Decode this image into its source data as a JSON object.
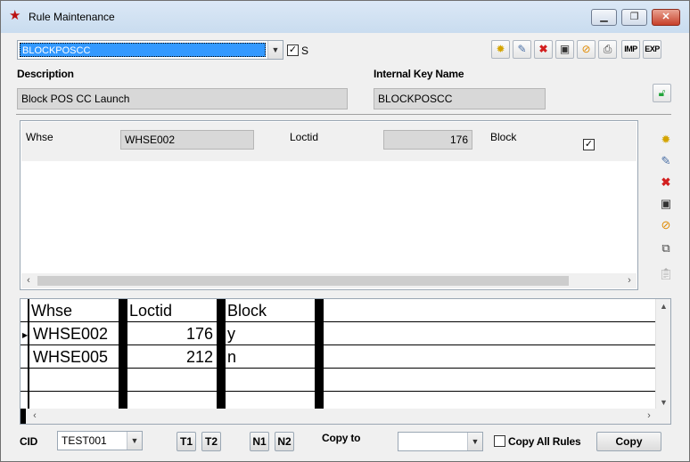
{
  "window": {
    "title": "Rule Maintenance",
    "controls": {
      "minimize": "▁",
      "maximize": "❐",
      "close": "✕"
    }
  },
  "rule_select": {
    "value": "BLOCKPOSCC",
    "s_checked": true,
    "s_label": "S"
  },
  "toolbar": {
    "imp": "IMP",
    "exp": "EXP"
  },
  "description": {
    "label": "Description",
    "value": "Block POS CC Launch"
  },
  "internal_key": {
    "label": "Internal Key Name",
    "value": "BLOCKPOSCC"
  },
  "detail": {
    "whse_label": "Whse",
    "whse_value": "WHSE002",
    "loctid_label": "Loctid",
    "loctid_value": "176",
    "block_label": "Block",
    "block_checked": true
  },
  "grid": {
    "columns": [
      "Whse",
      "Loctid",
      "Block"
    ],
    "rows": [
      {
        "whse": "WHSE002",
        "loctid": "176",
        "block": "y",
        "current": true
      },
      {
        "whse": "WHSE005",
        "loctid": "212",
        "block": "n",
        "current": false
      }
    ]
  },
  "footer": {
    "cid_label": "CID",
    "cid_value": "TEST001",
    "t1": "T1",
    "t2": "T2",
    "n1": "N1",
    "n2": "N2",
    "copy_to_label": "Copy to",
    "copy_to_value": "",
    "copy_all_label": "Copy All Rules",
    "copy_all_checked": false,
    "copy_button": "Copy"
  }
}
